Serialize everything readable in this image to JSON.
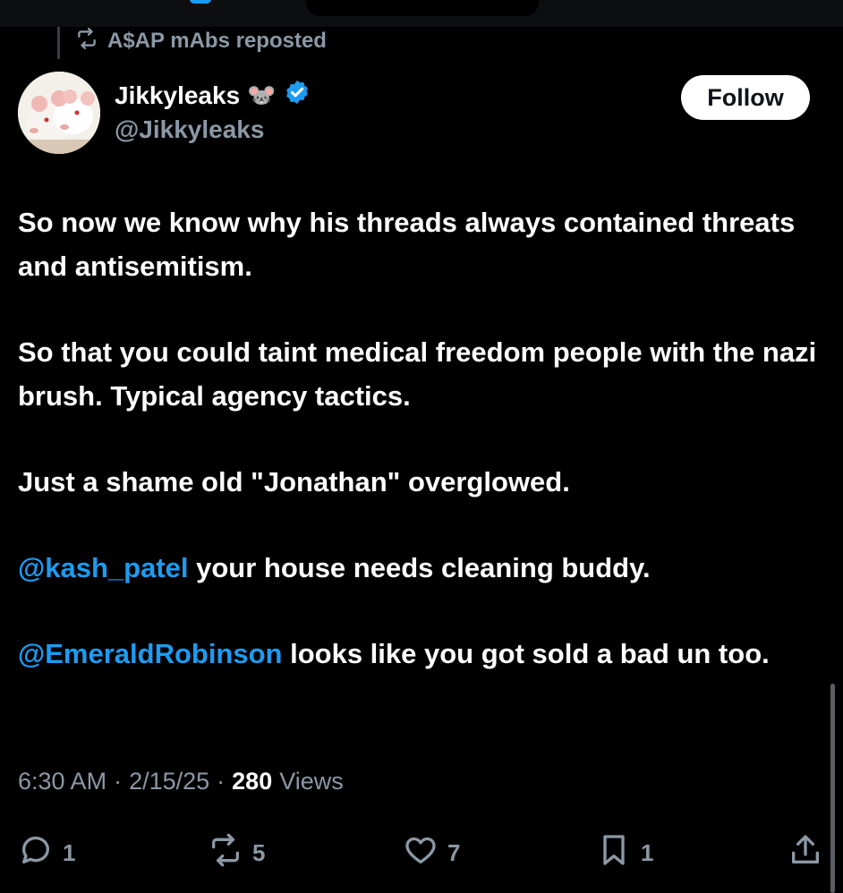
{
  "repost": {
    "label": "A$AP mAbs reposted"
  },
  "author": {
    "display_name": "Jikkyleaks",
    "name_emoji": "🐭",
    "handle": "@Jikkyleaks",
    "verified": true
  },
  "follow_button": {
    "label": "Follow"
  },
  "tweet": {
    "p1": "So now we know why his threads always contained threats and antisemitism.",
    "p2": "So that you could taint medical freedom people with the nazi brush. Typical agency tactics.",
    "p3": "Just a shame old \"Jonathan\" overglowed.",
    "p4_mention": "@kash_patel",
    "p4_text": " your house needs cleaning buddy.",
    "p5_mention": "@EmeraldRobinson",
    "p5_text": " looks like you got sold a bad un too."
  },
  "meta": {
    "time": "6:30 AM",
    "sep1": "·",
    "date": "2/15/25",
    "sep2": "·",
    "views_count": "280",
    "views_label": "Views"
  },
  "actions": {
    "replies": "1",
    "reposts": "5",
    "likes": "7",
    "bookmarks": "1"
  },
  "icons": [
    "repost-icon",
    "verified-badge-icon",
    "reply-icon",
    "like-icon",
    "bookmark-icon",
    "share-icon"
  ],
  "colors": {
    "accent": "#1d9bf0",
    "background": "#000000",
    "muted": "#8b98a5"
  }
}
